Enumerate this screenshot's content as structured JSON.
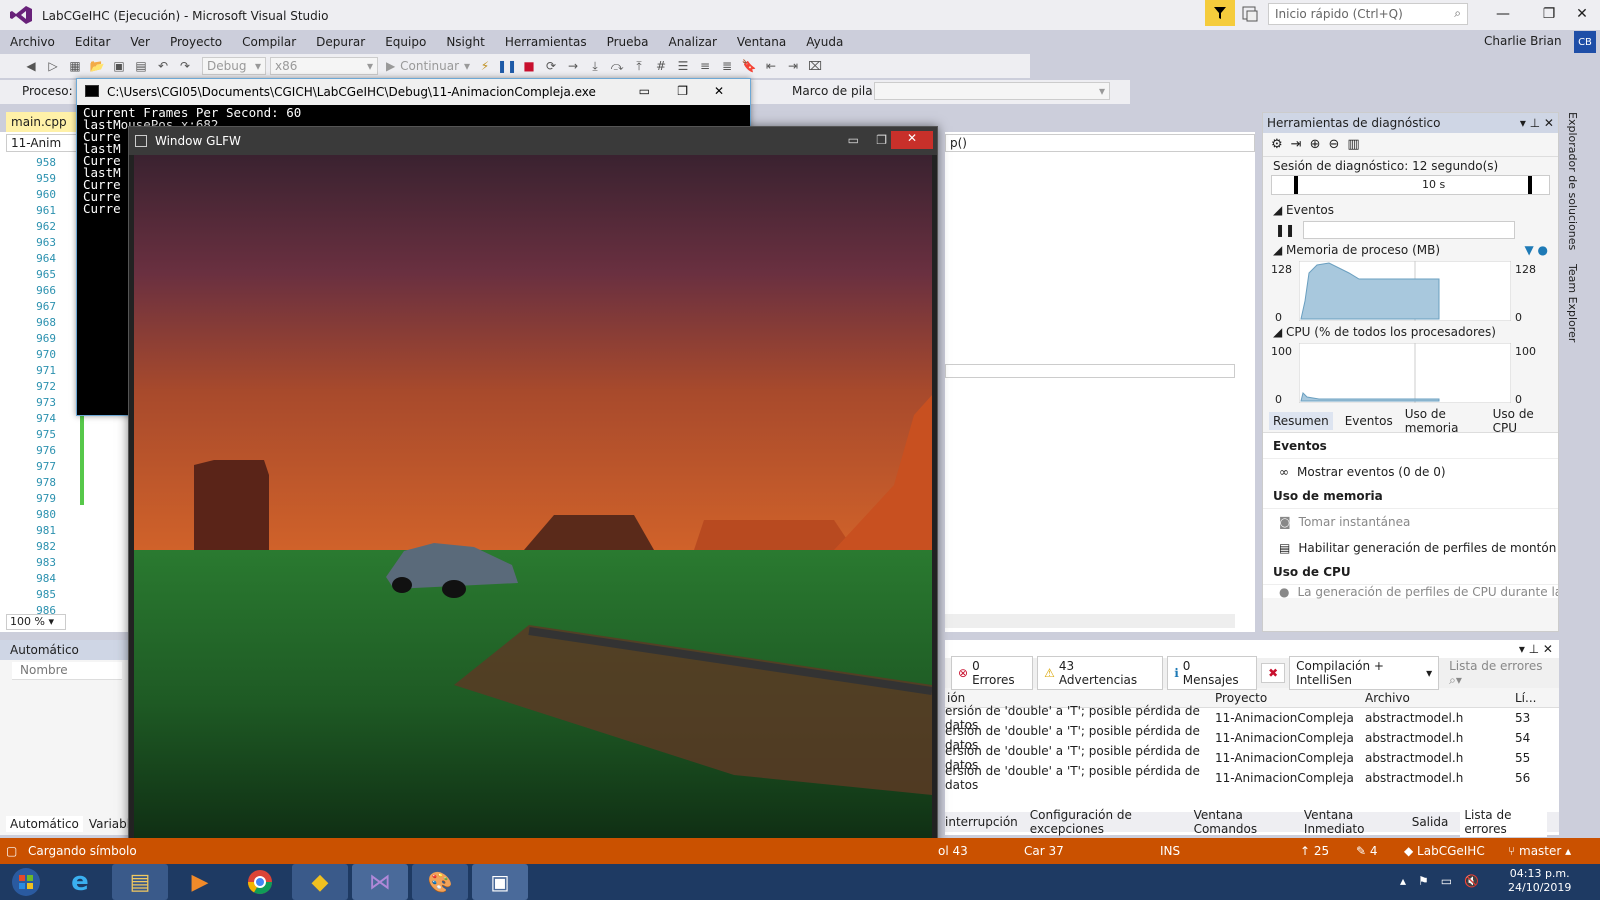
{
  "window": {
    "title": "LabCGeIHC (Ejecución) - Microsoft Visual Studio",
    "quick_launch_placeholder": "Inicio rápido (Ctrl+Q)"
  },
  "menu": {
    "items": [
      "Archivo",
      "Editar",
      "Ver",
      "Proyecto",
      "Compilar",
      "Depurar",
      "Equipo",
      "Nsight",
      "Herramientas",
      "Prueba",
      "Analizar",
      "Ventana",
      "Ayuda"
    ]
  },
  "account": {
    "name": "Charlie Brian",
    "initials": "CB"
  },
  "toolbar": {
    "config": "Debug",
    "platform": "x86",
    "continue_label": "Continuar"
  },
  "toolbar2": {
    "process_label": "Proceso:",
    "stack_label": "Marco de pila:"
  },
  "console": {
    "title": "C:\\Users\\CGI05\\Documents\\CGICH\\LabCGeIHC\\Debug\\11-AnimacionCompleja.exe",
    "lines": [
      "Current Frames Per Second: 60",
      "lastMousePos.x:682",
      "Curre",
      "lastM",
      "Curre",
      "lastM",
      "Curre",
      "Curre",
      "Curre"
    ]
  },
  "editor": {
    "tab_label": "main.cpp",
    "file_label": "11-Anim",
    "zoom": "100 %",
    "func_label": "p()",
    "line_numbers": [
      "958",
      "959",
      "960",
      "961",
      "962",
      "963",
      "964",
      "965",
      "966",
      "967",
      "968",
      "969",
      "970",
      "971",
      "972",
      "973",
      "974",
      "975",
      "976",
      "977",
      "978",
      "979",
      "980",
      "981",
      "982",
      "983",
      "984",
      "985",
      "986"
    ]
  },
  "glfw": {
    "title": "Window GLFW"
  },
  "diagnostics": {
    "panel_title": "Herramientas de diagnóstico",
    "session": "Sesión de diagnóstico: 12 segundo(s)",
    "timeline_mark": "10 s",
    "events_label": "Eventos",
    "memory_label": "Memoria de proceso (MB)",
    "memory_max": "128",
    "memory_min": "0",
    "cpu_label": "CPU (% de todos los procesadores)",
    "cpu_max": "100",
    "cpu_min": "0",
    "tabs": [
      "Resumen",
      "Eventos",
      "Uso de memoria",
      "Uso de CPU"
    ],
    "events_section": "Eventos",
    "show_events": "Mostrar eventos (0 de 0)",
    "memory_section": "Uso de memoria",
    "snapshot": "Tomar instantánea",
    "heap_profiling": "Habilitar generación de perfiles de montón (a",
    "cpu_section": "Uso de CPU",
    "cpu_note": "La generación de perfiles de CPU durante la d"
  },
  "autos": {
    "title": "Automático",
    "col_name": "Nombre",
    "tab_auto": "Automático",
    "tab_var": "Variabl"
  },
  "errors": {
    "errors_chip": "0 Errores",
    "warnings_chip": "43 Advertencias",
    "messages_chip": "0 Mensajes",
    "filter": "Compilación + IntelliSen",
    "search_placeholder": "Lista de errores",
    "col_desc": "ión",
    "col_project": "Proyecto",
    "col_file": "Archivo",
    "col_line": "Lí...",
    "rows": [
      {
        "desc": "ersión de 'double' a 'T'; posible pérdida de datos",
        "project": "11-AnimacionCompleja",
        "file": "abstractmodel.h",
        "line": "53"
      },
      {
        "desc": "ersión de 'double' a 'T'; posible pérdida de datos",
        "project": "11-AnimacionCompleja",
        "file": "abstractmodel.h",
        "line": "54"
      },
      {
        "desc": "ersión de 'double' a 'T'; posible pérdida de datos",
        "project": "11-AnimacionCompleja",
        "file": "abstractmodel.h",
        "line": "55"
      },
      {
        "desc": "ersión de 'double' a 'T'; posible pérdida de datos",
        "project": "11-AnimacionCompleja",
        "file": "abstractmodel.h",
        "line": "56"
      }
    ]
  },
  "bottom_tabs": [
    "interrupción",
    "Configuración de excepciones",
    "Ventana Comandos",
    "Ventana Inmediato",
    "Salida",
    "Lista de errores"
  ],
  "status": {
    "loading": "Cargando símbolo",
    "col": "ol 43",
    "car": "Car 37",
    "ins": "INS",
    "up": "25",
    "edits": "4",
    "repo": "LabCGeIHC",
    "branch": "master"
  },
  "right_vtabs": [
    "Explorador de soluciones",
    "Team Explorer"
  ],
  "clock": {
    "time": "04:13 p.m.",
    "date": "24/10/2019"
  },
  "colors": {
    "status_bar": "#ca5100",
    "accent": "#68217a",
    "taskbar": "#1e3a63"
  }
}
